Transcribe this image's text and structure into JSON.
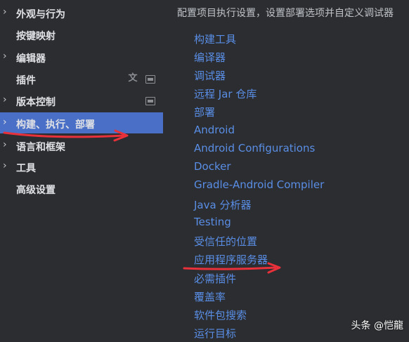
{
  "sidebar": {
    "items": [
      {
        "label": "外观与行为",
        "has_chevron": true
      },
      {
        "label": "按键映射",
        "has_chevron": false
      },
      {
        "label": "编辑器",
        "has_chevron": true
      },
      {
        "label": "插件",
        "has_chevron": false
      },
      {
        "label": "版本控制",
        "has_chevron": true
      },
      {
        "label": "构建、执行、部署",
        "has_chevron": true,
        "selected": true
      },
      {
        "label": "语言和框架",
        "has_chevron": true
      },
      {
        "label": "工具",
        "has_chevron": true
      },
      {
        "label": "高级设置",
        "has_chevron": false
      }
    ],
    "icons": {
      "chevron": "chevron-right-icon",
      "translate": "translate-icon",
      "window": "window-icon"
    }
  },
  "main": {
    "description": "配置项目执行设置，设置部署选项并自定义调试器",
    "links": [
      "构建工具",
      "编译器",
      "调试器",
      "远程 Jar 仓库",
      "部署",
      "Android",
      "Android Configurations",
      "Docker",
      "Gradle-Android Compiler",
      "Java 分析器",
      "Testing",
      "受信任的位置",
      "应用程序服务器",
      "必需插件",
      "覆盖率",
      "软件包搜索",
      "运行目标"
    ]
  },
  "colors": {
    "background": "#2b2d30",
    "selected": "#4a6fc6",
    "link": "#5a8ee6",
    "arrow": "#e8313a"
  },
  "watermark": "头条 @恺龍"
}
